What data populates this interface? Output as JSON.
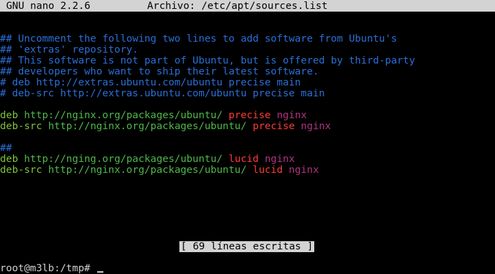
{
  "titlebar": {
    "app": "GNU nano 2.2.6",
    "file_label": "Archivo: /etc/apt/sources.list"
  },
  "comments": [
    "## Uncomment the following two lines to add software from Ubuntu's",
    "## 'extras' repository.",
    "## This software is not part of Ubuntu, but is offered by third-party",
    "## developers who want to ship their latest software.",
    "# deb http://extras.ubuntu.com/ubuntu precise main",
    "# deb-src http://extras.ubuntu.com/ubuntu precise main"
  ],
  "entries": [
    {
      "type": "deb",
      "url": "http://nginx.org/packages/ubuntu/",
      "dist": "precise",
      "component": "nginx"
    },
    {
      "type": "deb-src",
      "url": "http://nginx.org/packages/ubuntu/",
      "dist": "precise",
      "component": "nginx"
    },
    {
      "type": "deb",
      "url": "http://nging.org/packages/ubuntu/",
      "dist": "lucid",
      "component": "nginx"
    },
    {
      "type": "deb-src",
      "url": "http://nginx.org/packages/ubuntu/",
      "dist": "lucid",
      "component": "nginx"
    }
  ],
  "hash_line": "##",
  "status_message": "[ 69 líneas escritas ]",
  "prompt": "root@m3lb:/tmp# "
}
